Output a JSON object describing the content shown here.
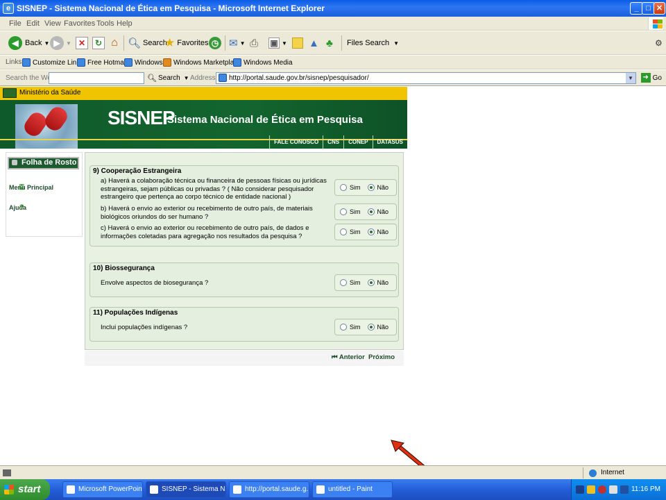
{
  "window": {
    "title": "SISNEP - Sistema Nacional de Ética em Pesquisa - Microsoft Internet Explorer"
  },
  "menu": [
    "File",
    "Edit",
    "View",
    "Favorites",
    "Tools",
    "Help"
  ],
  "toolbar": {
    "back": "Back",
    "search": "Search",
    "favorites": "Favorites",
    "files_search": "Files Search"
  },
  "links": {
    "label": "Links",
    "items": [
      "Customize Links",
      "Free Hotmail",
      "Windows",
      "Windows Marketplace",
      "Windows Media"
    ]
  },
  "addressbar": {
    "search_label": "Search the Web",
    "search_button": "Search",
    "address_label": "Address",
    "url": "http://portal.saude.gov.br/sisnep/pesquisador/",
    "go": "Go"
  },
  "site": {
    "ministry": "Ministério da Saúde",
    "logo": "SISNEP",
    "subtitle": "Sistema Nacional de Ética em Pesquisa",
    "nav": [
      "FALE CONOSCO",
      "CNS",
      "CONEP",
      "DATASUS"
    ]
  },
  "left": {
    "folha": "Folha de Rosto",
    "menu_principal": "Menu Principal",
    "ajuda": "Ajuda"
  },
  "form": {
    "sections": [
      {
        "title": "9) Cooperação Estrangeira",
        "questions": [
          {
            "text": "a) Haverá a colaboração técnica ou financeira de pessoas físicas ou jurídicas estrangeiras, sejam públicas ou privadas ? ( Não considerar pesquisador estrangeiro que pertença ao corpo técnico de entidade nacional )",
            "selected": "Não"
          },
          {
            "text": "b) Haverá o envio ao exterior ou recebimento de outro país, de materiais biológicos oriundos do ser humano ?",
            "selected": "Não"
          },
          {
            "text": "c) Haverá o envio ao exterior ou recebimento de outro país, de dados e informações coletadas para agregação nos resultados da pesquisa ?",
            "selected": "Não"
          }
        ]
      },
      {
        "title": "10) Biossegurança",
        "questions": [
          {
            "text": "Envolve aspectos de biosegurança ?",
            "selected": "Não"
          }
        ]
      },
      {
        "title": "11) Populações Indígenas",
        "questions": [
          {
            "text": "Inclui populações indígenas ?",
            "selected": "Não"
          }
        ]
      }
    ],
    "yes_label": "Sim",
    "no_label": "Não",
    "prev": "⏮ Anterior",
    "next": "Próximo"
  },
  "status": {
    "zone": "Internet"
  },
  "taskbar": {
    "start": "start",
    "tasks": [
      "Microsoft PowerPoint ...",
      "SISNEP - Sistema Nac...",
      "http://portal.saude.g...",
      "untitled - Paint"
    ],
    "clock": "11:16 PM"
  },
  "colors": {
    "site_green": "#13652f",
    "ministry_yellow": "#f1c400",
    "annotation_red": "#e03010"
  }
}
